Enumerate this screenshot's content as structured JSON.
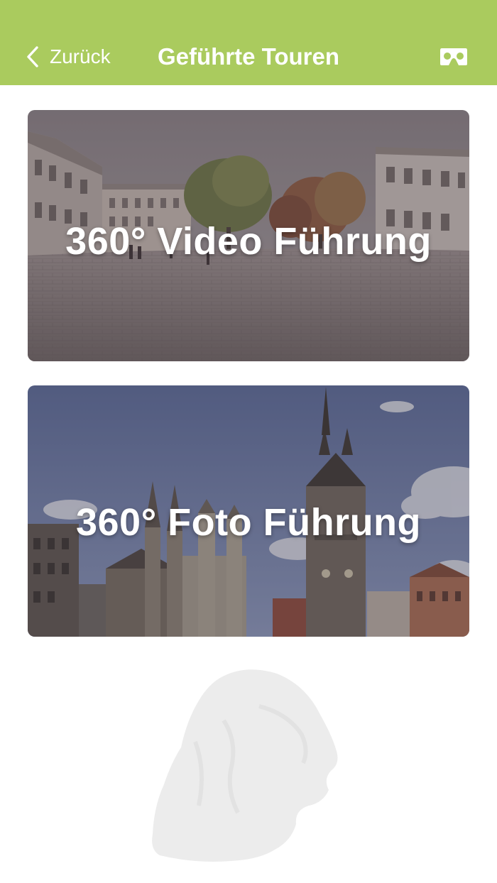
{
  "navbar": {
    "back_label": "Zurück",
    "title": "Geführte Touren",
    "back_icon": "chevron-left-icon",
    "vr_icon": "cardboard-vr-icon"
  },
  "cards": [
    {
      "label": "360° Video Führung"
    },
    {
      "label": "360° Foto Führung"
    }
  ],
  "watermark_icon": "lion-head-watermark",
  "colors": {
    "accent": "#aacb5e",
    "text_on_accent": "#ffffff",
    "watermark": "#ececec"
  }
}
